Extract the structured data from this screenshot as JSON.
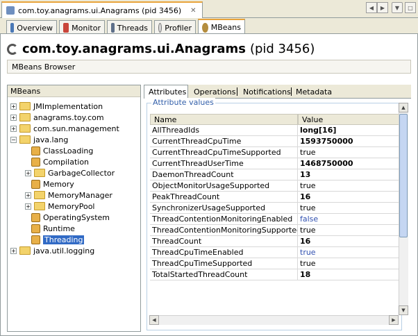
{
  "doc_tab": {
    "title": "com.toy.anagrams.ui.Anagrams (pid 3456)",
    "close": "✕"
  },
  "nav": {
    "prev": "◀",
    "next": "▶",
    "menu": "▼",
    "restore": "□"
  },
  "subtabs": [
    {
      "label": "Overview"
    },
    {
      "label": "Monitor"
    },
    {
      "label": "Threads"
    },
    {
      "label": "Profiler"
    },
    {
      "label": "MBeans"
    }
  ],
  "header": {
    "title": "com.toy.anagrams.ui.Anagrams",
    "pid": "(pid 3456)"
  },
  "subtitle": "MBeans Browser",
  "tree": {
    "title": "MBeans",
    "items": [
      {
        "label": "JMImplementation"
      },
      {
        "label": "anagrams.toy.com"
      },
      {
        "label": "com.sun.management"
      },
      {
        "label": "java.lang"
      },
      {
        "label": "ClassLoading"
      },
      {
        "label": "Compilation"
      },
      {
        "label": "GarbageCollector"
      },
      {
        "label": "Memory"
      },
      {
        "label": "MemoryManager"
      },
      {
        "label": "MemoryPool"
      },
      {
        "label": "OperatingSystem"
      },
      {
        "label": "Runtime"
      },
      {
        "label": "Threading"
      },
      {
        "label": "java.util.logging"
      }
    ]
  },
  "right_tabs": [
    "Attributes",
    "Operations",
    "Notifications",
    "Metadata"
  ],
  "attributes": {
    "legend": "Attribute values",
    "col_name": "Name",
    "col_value": "Value",
    "rows": [
      {
        "name": "AllThreadIds",
        "value": "long[16]"
      },
      {
        "name": "CurrentThreadCpuTime",
        "value": "1593750000"
      },
      {
        "name": "CurrentThreadCpuTimeSupported",
        "value": "true"
      },
      {
        "name": "CurrentThreadUserTime",
        "value": "1468750000"
      },
      {
        "name": "DaemonThreadCount",
        "value": "13"
      },
      {
        "name": "ObjectMonitorUsageSupported",
        "value": "true"
      },
      {
        "name": "PeakThreadCount",
        "value": "16"
      },
      {
        "name": "SynchronizerUsageSupported",
        "value": "true"
      },
      {
        "name": "ThreadContentionMonitoringEnabled",
        "value": "false"
      },
      {
        "name": "ThreadContentionMonitoringSupported",
        "value": "true"
      },
      {
        "name": "ThreadCount",
        "value": "16"
      },
      {
        "name": "ThreadCpuTimeEnabled",
        "value": "true"
      },
      {
        "name": "ThreadCpuTimeSupported",
        "value": "true"
      },
      {
        "name": "TotalStartedThreadCount",
        "value": "18"
      }
    ]
  },
  "scroll": {
    "up": "▲",
    "down": "▼",
    "left": "◀",
    "right": "▶"
  }
}
